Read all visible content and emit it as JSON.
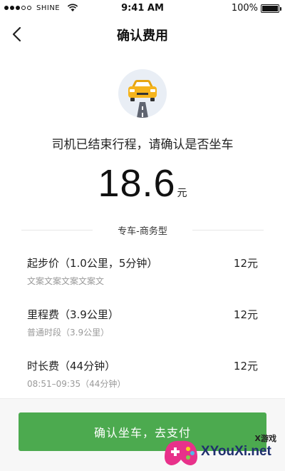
{
  "status_bar": {
    "carrier": "SHINE",
    "time": "9:41 AM",
    "battery": "100%",
    "battery_level": 1.0
  },
  "nav": {
    "title": "确认费用"
  },
  "trip": {
    "headline": "司机已结束行程，请确认是否坐车",
    "amount": "18.6",
    "unit": "元",
    "car_type": "专车-商务型"
  },
  "fees": [
    {
      "name": "起步价（1.0公里，5分钟）",
      "price": "12元",
      "note": "文案文案文案文案文"
    },
    {
      "name": "里程费（3.9公里）",
      "price": "12元",
      "note": "普通时段（3.9公里）"
    },
    {
      "name": "时长费（44分钟）",
      "price": "12元",
      "note": "08:51–09:35（44分钟）"
    }
  ],
  "action": {
    "confirm_label": "确认坐车，去支付"
  },
  "watermark": {
    "small_text": "X游戏",
    "site": "XYouXi.net"
  },
  "colors": {
    "primary_green": "#4caa4f",
    "car_yellow": "#f5b41d"
  },
  "icons": {
    "back": "chevron-left-icon",
    "car": "car-icon",
    "wifi": "wifi-icon",
    "battery": "battery-icon"
  }
}
